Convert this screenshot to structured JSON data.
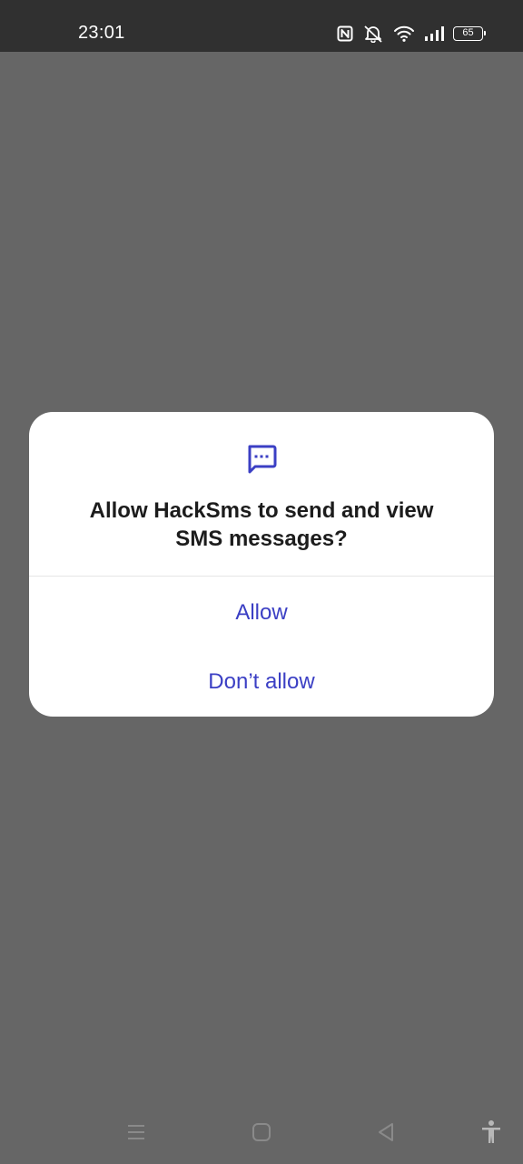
{
  "status_bar": {
    "time": "23:01",
    "battery_level": "65",
    "icons": [
      "nfc-icon",
      "mute-icon",
      "wifi-icon",
      "signal-icon",
      "battery-icon"
    ]
  },
  "dialog": {
    "icon": "sms-icon",
    "title_line1": "Allow HackSms to send and view",
    "title_line2": "SMS messages?",
    "allow_label": "Allow",
    "deny_label": "Don’t allow"
  },
  "nav_bar": {
    "icons": [
      "menu-icon",
      "home-icon",
      "back-icon",
      "accessibility-icon"
    ]
  },
  "colors": {
    "accent": "#3b3fc4",
    "scrim": "#666666",
    "status_bar": "#303030",
    "dialog_bg": "#ffffff",
    "title_text": "#1c1c1c"
  }
}
